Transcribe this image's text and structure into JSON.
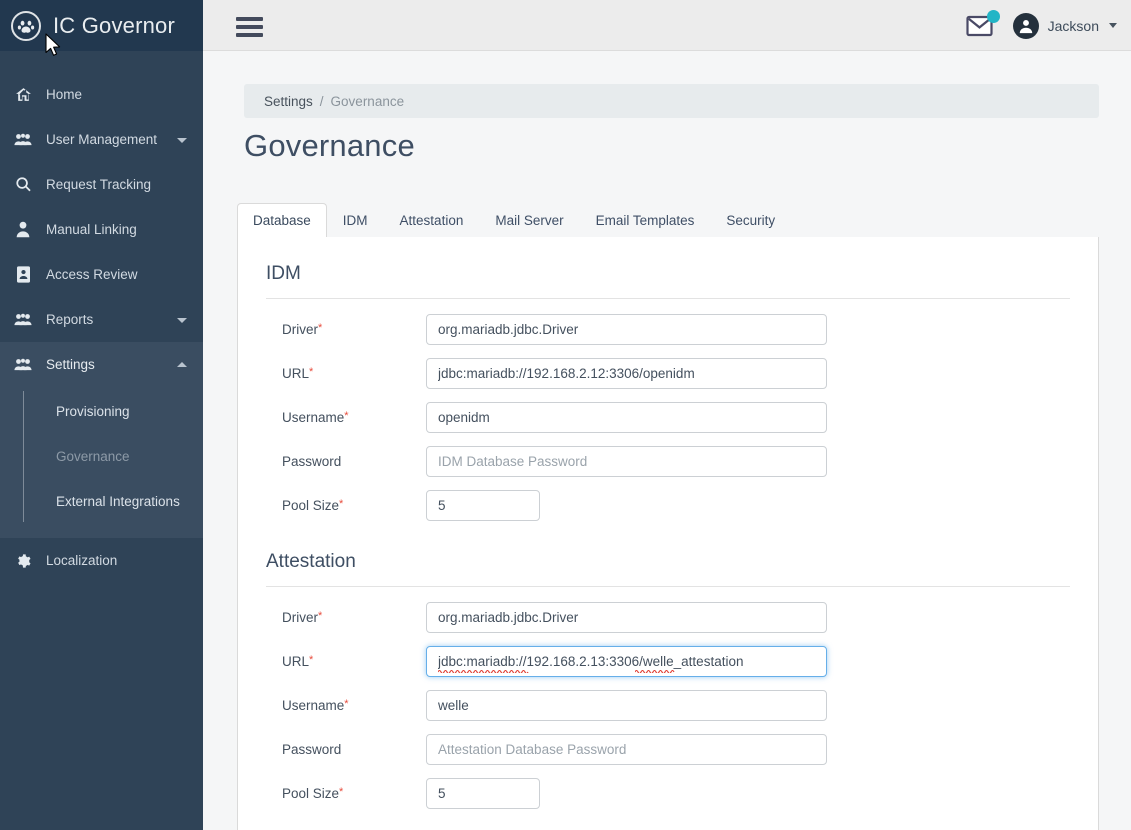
{
  "brand": {
    "title": "IC Governor",
    "logo_icon": "paw-circle-icon"
  },
  "topbar": {
    "menu_toggle_icon": "hamburger-icon",
    "mail_icon": "envelope-icon",
    "notification_color": "#23b5c6",
    "avatar_icon": "user-avatar-icon",
    "user_name": "Jackson",
    "user_caret_icon": "chevron-down-icon"
  },
  "sidebar": {
    "background": "#2f4357",
    "submenu_background": "#3a4d61",
    "items": [
      {
        "label": "Home",
        "icon": "home-icon",
        "expandable": false,
        "active": false
      },
      {
        "label": "User Management",
        "icon": "users-icon",
        "expandable": true,
        "expanded": false,
        "active": false
      },
      {
        "label": "Request Tracking",
        "icon": "search-icon",
        "expandable": false,
        "active": false
      },
      {
        "label": "Manual Linking",
        "icon": "person-icon",
        "expandable": false,
        "active": false
      },
      {
        "label": "Access Review",
        "icon": "id-card-icon",
        "expandable": false,
        "active": false
      },
      {
        "label": "Reports",
        "icon": "users-icon",
        "expandable": true,
        "expanded": false,
        "active": false
      },
      {
        "label": "Settings",
        "icon": "users-icon",
        "expandable": true,
        "expanded": true,
        "active": true
      },
      {
        "label": "Localization",
        "icon": "gear-icon",
        "expandable": false,
        "active": false
      }
    ],
    "settings_submenu": [
      {
        "label": "Provisioning",
        "current": false
      },
      {
        "label": "Governance",
        "current": true
      },
      {
        "label": "External Integrations",
        "current": false
      }
    ]
  },
  "breadcrumb": {
    "root": "Settings",
    "separator": "/",
    "leaf": "Governance"
  },
  "page": {
    "title": "Governance"
  },
  "tabs": [
    {
      "label": "Database",
      "active": true
    },
    {
      "label": "IDM",
      "active": false
    },
    {
      "label": "Attestation",
      "active": false
    },
    {
      "label": "Mail Server",
      "active": false
    },
    {
      "label": "Email Templates",
      "active": false
    },
    {
      "label": "Security",
      "active": false
    }
  ],
  "sections": {
    "idm": {
      "title": "IDM",
      "driver": {
        "label": "Driver",
        "required": true,
        "value": "org.mariadb.jdbc.Driver",
        "placeholder": ""
      },
      "url": {
        "label": "URL",
        "required": true,
        "value": "jdbc:mariadb://192.168.2.12:3306/openidm",
        "placeholder": ""
      },
      "username": {
        "label": "Username",
        "required": true,
        "value": "openidm",
        "placeholder": ""
      },
      "password": {
        "label": "Password",
        "required": false,
        "value": "",
        "placeholder": "IDM Database Password"
      },
      "pool_size": {
        "label": "Pool Size",
        "required": true,
        "value": "5",
        "placeholder": ""
      }
    },
    "attestation": {
      "title": "Attestation",
      "driver": {
        "label": "Driver",
        "required": true,
        "value": "org.mariadb.jdbc.Driver",
        "placeholder": ""
      },
      "url": {
        "label": "URL",
        "required": true,
        "value": "jdbc:mariadb://192.168.2.13:3306/welle_attestation",
        "placeholder": "",
        "focused": true
      },
      "username": {
        "label": "Username",
        "required": true,
        "value": "welle",
        "placeholder": ""
      },
      "password": {
        "label": "Password",
        "required": false,
        "value": "",
        "placeholder": "Attestation Database Password"
      },
      "pool_size": {
        "label": "Pool Size",
        "required": true,
        "value": "5",
        "placeholder": ""
      }
    }
  },
  "colors": {
    "focus_border": "#66afe9",
    "required_marker": "#e74c3c",
    "title": "#3e4e63"
  }
}
